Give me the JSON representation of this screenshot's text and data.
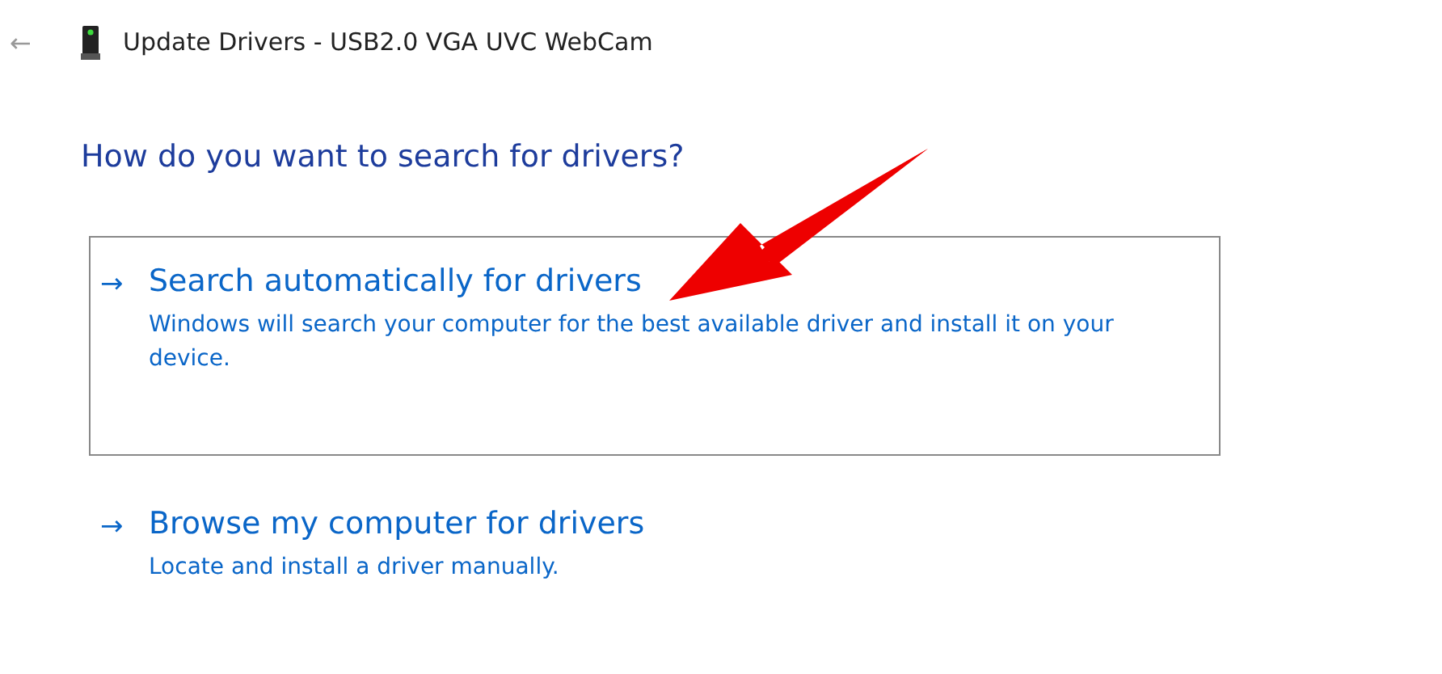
{
  "window": {
    "back": "←",
    "title": "Update Drivers - USB2.0 VGA UVC WebCam"
  },
  "heading": "How do you want to search for drivers?",
  "options": [
    {
      "arrow": "→",
      "title": "Search automatically for drivers",
      "description": "Windows will search your computer for the best available driver and install it on your device.",
      "selected": true
    },
    {
      "arrow": "→",
      "title": "Browse my computer for drivers",
      "description": "Locate and install a driver manually.",
      "selected": false
    }
  ]
}
